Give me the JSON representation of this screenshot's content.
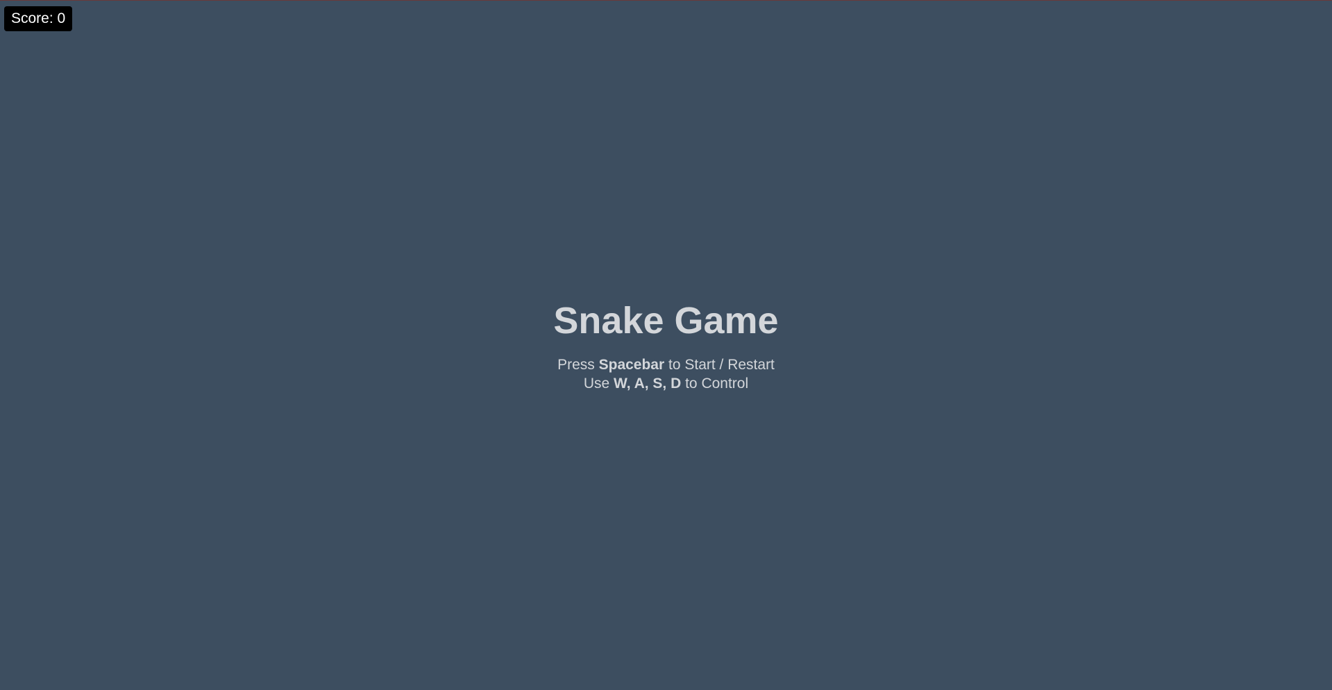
{
  "hud": {
    "score_label": "Score:",
    "score_value": "0"
  },
  "overlay": {
    "title": "Snake Game",
    "line1": {
      "prefix": "Press ",
      "key": "Spacebar",
      "suffix": " to Start / Restart"
    },
    "line2": {
      "prefix": "Use ",
      "keys": "W, A, S, D",
      "suffix": " to Control"
    }
  },
  "colors": {
    "background": "#3d4e60",
    "overlay_text": "#d3d6da",
    "score_box": "#000000",
    "score_text": "#ffffff"
  }
}
